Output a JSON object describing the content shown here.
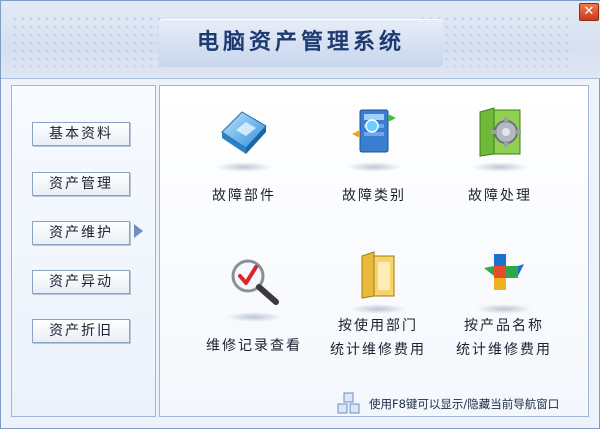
{
  "window": {
    "title": "电脑资产管理系统",
    "close_symbol": "✕"
  },
  "sidebar": {
    "items": [
      {
        "label": "基本资料"
      },
      {
        "label": "资产管理"
      },
      {
        "label": "资产维护"
      },
      {
        "label": "资产异动"
      },
      {
        "label": "资产折旧"
      }
    ],
    "selected_index": 2
  },
  "main": {
    "tiles": [
      {
        "label": "故障部件",
        "icon": "component-icon"
      },
      {
        "label": "故障类别",
        "icon": "server-icon"
      },
      {
        "label": "故障处理",
        "icon": "folder-gear-icon"
      },
      {
        "label": "维修记录查看",
        "icon": "magnifier-icon"
      },
      {
        "label_line1": "按使用部门",
        "label_line2": "统计维修费用",
        "icon": "folder-icon"
      },
      {
        "label_line1": "按产品名称",
        "label_line2": "统计维修费用",
        "icon": "puzzle-icon"
      }
    ]
  },
  "footer": {
    "hint": "使用F8键可以显示/隐藏当前导航窗口",
    "icon": "cubes-icon"
  },
  "colors": {
    "accent": "#1e3a73",
    "border": "#9fb6d8",
    "close": "#d24a23"
  }
}
